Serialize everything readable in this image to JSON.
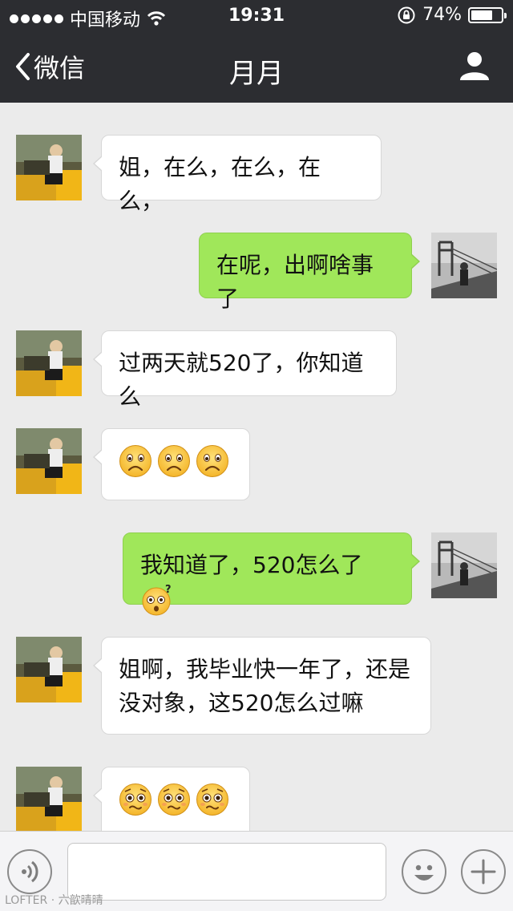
{
  "status_bar": {
    "carrier": "中国移动",
    "time": "19:31",
    "battery_text": "74%",
    "battery_level": 0.74
  },
  "nav": {
    "back_label": "微信",
    "title": "月月"
  },
  "messages": [
    {
      "side": "in",
      "text": "姐，在么，在么，在么，"
    },
    {
      "side": "out",
      "text": "在呢，出啊啥事了"
    },
    {
      "side": "in",
      "text": "过两天就520了，你知道么"
    },
    {
      "side": "in",
      "emoji": [
        "sad-face-icon",
        "sad-face-icon",
        "sad-face-icon"
      ]
    },
    {
      "side": "out",
      "text": "我知道了，520怎么了",
      "trailing_emoji": "confused-face-icon"
    },
    {
      "side": "in",
      "text_lines": [
        "姐啊，我毕业快一年了，还是",
        "没对象，这520怎么过嘛"
      ]
    },
    {
      "side": "in",
      "emoji": [
        "pleading-face-icon",
        "pleading-face-icon",
        "pleading-face-icon"
      ]
    }
  ],
  "input_bar": {
    "voice_icon": "voice-icon",
    "emoji_icon": "smile-icon",
    "plus_icon": "plus-icon"
  },
  "watermark": "LOFTER · 六歆晴晴",
  "colors": {
    "header_bg": "#2c2d31",
    "chat_bg": "#ebebeb",
    "outgoing_bubble": "#a0e75a",
    "incoming_bubble": "#ffffff"
  }
}
